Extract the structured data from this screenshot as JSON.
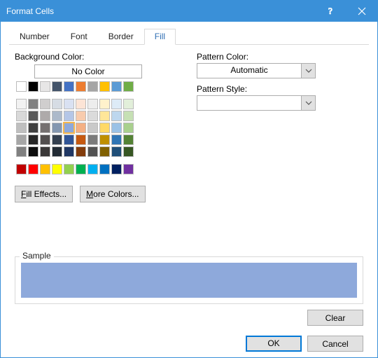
{
  "window": {
    "title": "Format Cells"
  },
  "tabs": {
    "number": "Number",
    "font": "Font",
    "border": "Border",
    "fill": "Fill",
    "active": "fill"
  },
  "fill": {
    "background_label": "Background Color:",
    "no_color_label": "No Color",
    "fill_effects_btn": "Fill Effects...",
    "more_colors_btn": "More Colors...",
    "theme_rows": [
      [
        "#ffffff",
        "#000000",
        "#e7e6e6",
        "#44546a",
        "#4472c4",
        "#ed7d31",
        "#a5a5a5",
        "#ffc000",
        "#5b9bd5",
        "#70ad47"
      ],
      [
        "#f2f2f2",
        "#808080",
        "#d0cece",
        "#d6dce4",
        "#d9e1f2",
        "#fce4d6",
        "#ededed",
        "#fff2cc",
        "#ddebf7",
        "#e2efda"
      ],
      [
        "#d9d9d9",
        "#595959",
        "#aeaaaa",
        "#acb9ca",
        "#b4c6e7",
        "#f8cbad",
        "#dbdbdb",
        "#ffe699",
        "#bdd7ee",
        "#c6e0b4"
      ],
      [
        "#bfbfbf",
        "#404040",
        "#757171",
        "#8497b0",
        "#8ea9db",
        "#f4b084",
        "#c9c9c9",
        "#ffd966",
        "#9bc2e6",
        "#a9d08e"
      ],
      [
        "#a6a6a6",
        "#262626",
        "#524f4f",
        "#333f4f",
        "#305496",
        "#c65911",
        "#7b7b7b",
        "#bf8f00",
        "#2f75b5",
        "#548235"
      ],
      [
        "#808080",
        "#0d0d0d",
        "#3a3838",
        "#222b35",
        "#203764",
        "#833c0c",
        "#525252",
        "#806000",
        "#1f4e78",
        "#375623"
      ]
    ],
    "standard_row": [
      "#c00000",
      "#ff0000",
      "#ffc000",
      "#ffff00",
      "#92d050",
      "#00b050",
      "#00b0f0",
      "#0070c0",
      "#002060",
      "#7030a0"
    ],
    "selected_color": "#8ea9db"
  },
  "pattern": {
    "color_label": "Pattern Color:",
    "color_value": "Automatic",
    "style_label": "Pattern Style:",
    "style_value": ""
  },
  "sample": {
    "label": "Sample",
    "color": "#8ea9db"
  },
  "buttons": {
    "clear": "Clear",
    "ok": "OK",
    "cancel": "Cancel"
  }
}
